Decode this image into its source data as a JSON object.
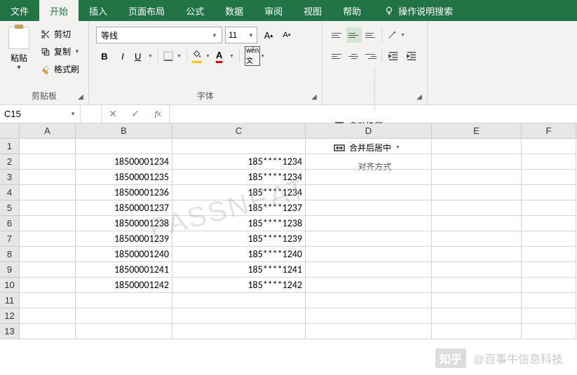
{
  "tabs": {
    "file": "文件",
    "home": "开始",
    "insert": "插入",
    "layout": "页面布局",
    "formulas": "公式",
    "data": "数据",
    "review": "审阅",
    "view": "视图",
    "help": "帮助",
    "tell_me": "操作说明搜索"
  },
  "ribbon": {
    "clipboard": {
      "paste": "粘贴",
      "cut": "剪切",
      "copy": "复制",
      "format_painter": "格式刷",
      "label": "剪贴板"
    },
    "font": {
      "name": "等线",
      "size": "11",
      "label": "字体"
    },
    "alignment": {
      "wrap": "自动换行",
      "merge": "合并后居中",
      "label": "对齐方式"
    }
  },
  "formula_bar": {
    "name_box": "C15",
    "value": ""
  },
  "columns": [
    "A",
    "B",
    "C",
    "D",
    "E",
    "F"
  ],
  "rows": [
    {
      "n": "1",
      "A": "",
      "B": "",
      "C": ""
    },
    {
      "n": "2",
      "A": "",
      "B": "18500001234",
      "C": "185****1234"
    },
    {
      "n": "3",
      "A": "",
      "B": "18500001235",
      "C": "185****1234"
    },
    {
      "n": "4",
      "A": "",
      "B": "18500001236",
      "C": "185****1234"
    },
    {
      "n": "5",
      "A": "",
      "B": "18500001237",
      "C": "185****1237"
    },
    {
      "n": "6",
      "A": "",
      "B": "18500001238",
      "C": "185****1238"
    },
    {
      "n": "7",
      "A": "",
      "B": "18500001239",
      "C": "185****1239"
    },
    {
      "n": "8",
      "A": "",
      "B": "18500001240",
      "C": "185****1240"
    },
    {
      "n": "9",
      "A": "",
      "B": "18500001241",
      "C": "185****1241"
    },
    {
      "n": "10",
      "A": "",
      "B": "18500001242",
      "C": "185****1242"
    },
    {
      "n": "11",
      "A": "",
      "B": "",
      "C": ""
    },
    {
      "n": "12",
      "A": "",
      "B": "",
      "C": ""
    },
    {
      "n": "13",
      "A": "",
      "B": "",
      "C": ""
    }
  ],
  "watermark": "PASSNEAT",
  "zhihu": {
    "logo": "知乎",
    "author": "@百事牛信息科技"
  }
}
